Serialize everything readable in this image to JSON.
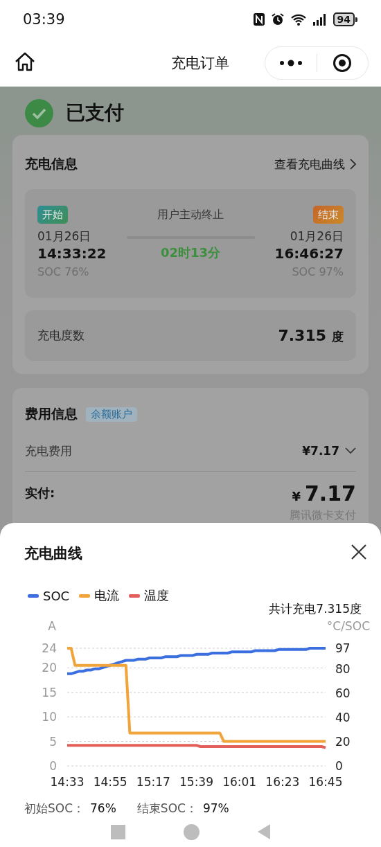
{
  "status_bar": {
    "time": "03:39",
    "battery": "94"
  },
  "nav": {
    "title": "充电订单"
  },
  "order": {
    "status": "已支付"
  },
  "charge_info": {
    "title": "充电信息",
    "link": "查看充电曲线",
    "start": {
      "tag": "开始",
      "date": "01月26日",
      "time": "14:33:22",
      "soc": "SOC 76%"
    },
    "stop_reason": "用户主动终止",
    "duration": "02时13分",
    "end": {
      "tag": "结束",
      "date": "01月26日",
      "time": "16:46:27",
      "soc": "SOC 97%"
    },
    "energy": {
      "label": "充电度数",
      "value": "7.315",
      "unit": "度"
    }
  },
  "fee_info": {
    "title": "费用信息",
    "tag": "余额账户",
    "rows": [
      {
        "label": "充电费用",
        "value": "¥7.17",
        "expanded": false
      }
    ],
    "paid": {
      "label": "实付:",
      "currency": "¥",
      "amount": "7.17",
      "method": "腾讯微卡支付"
    }
  },
  "curve_sheet": {
    "title": "充电曲线",
    "total": "共计充电7.315度",
    "chart_data": {
      "type": "line",
      "grid": true,
      "ylabel": "A",
      "y2label": "°C/SOC",
      "ylim": [
        0,
        24
      ],
      "y2lim": [
        0,
        97
      ],
      "categories": [
        "14:33",
        null,
        null,
        null,
        null,
        null,
        null,
        null,
        null,
        null,
        null,
        "14:55",
        null,
        null,
        null,
        null,
        null,
        null,
        null,
        null,
        null,
        null,
        "15:17",
        null,
        null,
        null,
        null,
        null,
        null,
        null,
        null,
        null,
        null,
        "15:39",
        null,
        null,
        null,
        null,
        null,
        null,
        null,
        null,
        null,
        null,
        "16:01",
        null,
        null,
        null,
        null,
        null,
        null,
        null,
        null,
        null,
        null,
        "16:23",
        null,
        null,
        null,
        null,
        null,
        null,
        null,
        null,
        null,
        null,
        "16:45"
      ],
      "yticks": [
        0,
        5,
        10,
        15,
        20,
        24
      ],
      "y2ticks": [
        0,
        20,
        40,
        60,
        80,
        97
      ],
      "series": [
        {
          "name": "SOC",
          "color": "#3b6fe0",
          "axis": "y2",
          "values": [
            76,
            76,
            77,
            78,
            78,
            79,
            79,
            80,
            80,
            81,
            82,
            83,
            84,
            85,
            86,
            87,
            87,
            87,
            88,
            88,
            88,
            89,
            89,
            89,
            89,
            90,
            90,
            90,
            90,
            91,
            91,
            91,
            91,
            92,
            92,
            92,
            92,
            93,
            93,
            93,
            93,
            93,
            94,
            94,
            94,
            94,
            94,
            94,
            95,
            95,
            95,
            95,
            95,
            95,
            96,
            96,
            96,
            96,
            96,
            96,
            96,
            96,
            97,
            97,
            97,
            97,
            97
          ]
        },
        {
          "name": "电流",
          "color": "#f0a43a",
          "values": [
            24,
            24,
            20.5,
            20.5,
            20.5,
            20.5,
            20.5,
            20.5,
            20.5,
            20.5,
            20.5,
            20.5,
            20.5,
            20.5,
            20.5,
            20.5,
            6.7,
            6.7,
            6.7,
            6.7,
            6.7,
            6.7,
            6.7,
            6.7,
            6.7,
            6.7,
            6.7,
            6.7,
            6.7,
            6.7,
            6.7,
            6.7,
            6.7,
            6.7,
            6.7,
            6.7,
            6.7,
            6.7,
            6.7,
            6.7,
            5,
            5,
            5,
            5,
            5,
            5,
            5,
            5,
            5,
            5,
            5,
            5,
            5,
            5,
            5,
            5,
            5,
            5,
            5,
            5,
            5,
            5,
            5,
            5,
            5,
            5,
            5
          ]
        },
        {
          "name": "温度",
          "color": "#e35f5a",
          "axis": "y2",
          "values": [
            17,
            17,
            17,
            17,
            17,
            17,
            17,
            17,
            17,
            17,
            17,
            17,
            17,
            17,
            17,
            17,
            17,
            17,
            17,
            17,
            17,
            17,
            17,
            17,
            17,
            17,
            17,
            17,
            17,
            17,
            17,
            17,
            17,
            17,
            16,
            16,
            16,
            16,
            16,
            16,
            16,
            16,
            16,
            16,
            16,
            16,
            16,
            16,
            16,
            16,
            16,
            16,
            16,
            16,
            16,
            16,
            16,
            16,
            16,
            16,
            16,
            16,
            16,
            16,
            16,
            16,
            15
          ]
        }
      ]
    },
    "start_soc": {
      "label": "初始SOC：",
      "value": "76%"
    },
    "end_soc": {
      "label": "结束SOC：",
      "value": "97%"
    }
  }
}
